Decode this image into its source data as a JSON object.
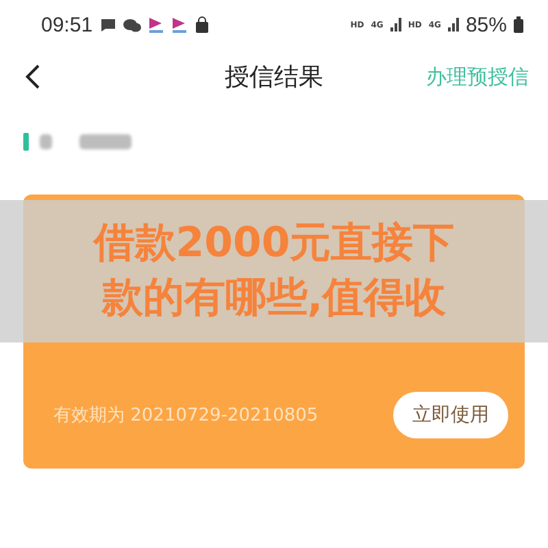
{
  "status_bar": {
    "time": "09:51",
    "network_labels": [
      "HD",
      "4G",
      "HD",
      "4G"
    ],
    "battery": "85%"
  },
  "header": {
    "title": "授信结果",
    "action": "办理预授信"
  },
  "card": {
    "validity": "有效期为 20210729-20210805",
    "button": "立即使用"
  },
  "overlay_caption": {
    "lines": [
      "借款2000元直接下",
      "款的有哪些,值得收"
    ]
  }
}
